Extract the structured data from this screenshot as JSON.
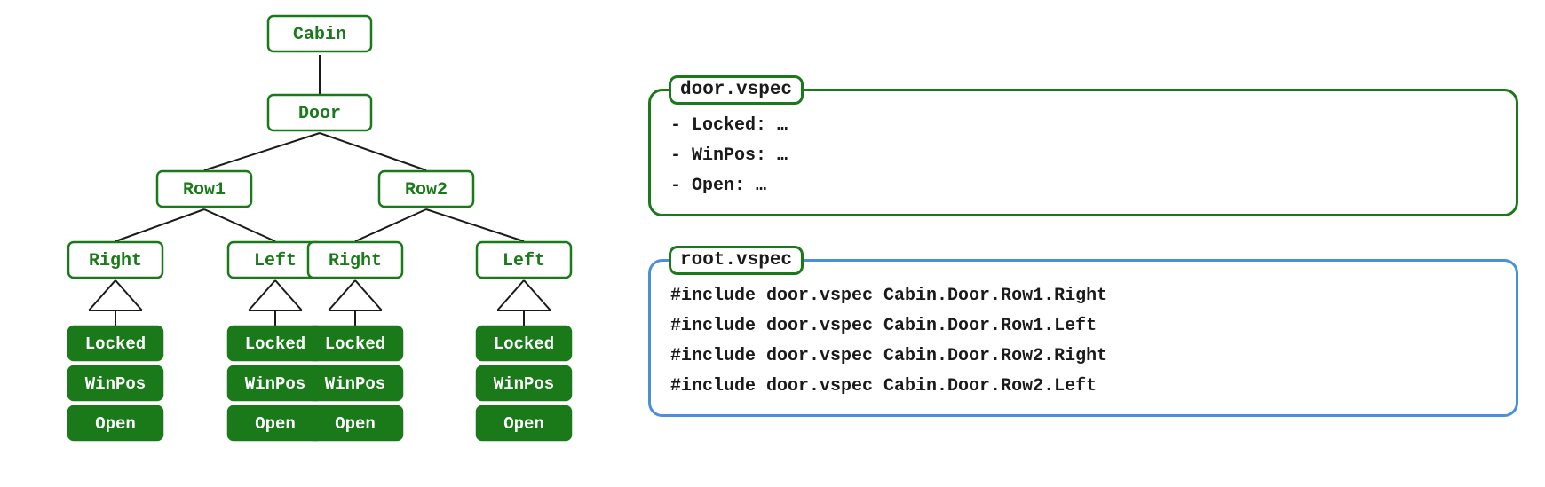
{
  "tree": {
    "nodes": {
      "cabin": "Cabin",
      "door": "Door",
      "row1": "Row1",
      "row2": "Row2",
      "r1right": "Right",
      "r1left": "Left",
      "r2right": "Right",
      "r2left": "Left",
      "r1r_locked": "Locked",
      "r1r_winpos": "WinPos",
      "r1r_open": "Open",
      "r1l_locked": "Locked",
      "r1l_winpos": "WinPos",
      "r1l_open": "Open",
      "r2r_locked": "Locked",
      "r2r_winpos": "WinPos",
      "r2r_open": "Open",
      "r2l_locked": "Locked",
      "r2l_winpos": "WinPos",
      "r2l_open": "Open"
    }
  },
  "door_panel": {
    "title": "door.vspec",
    "lines": [
      "- Locked: …",
      "- WinPos: …",
      "- Open: …"
    ]
  },
  "root_panel": {
    "title": "root.vspec",
    "lines": [
      "#include door.vspec Cabin.Door.Row1.Right",
      "#include door.vspec Cabin.Door.Row1.Left",
      "#include door.vspec Cabin.Door.Row2.Right",
      "#include door.vspec Cabin.Door.Row2.Left"
    ]
  }
}
